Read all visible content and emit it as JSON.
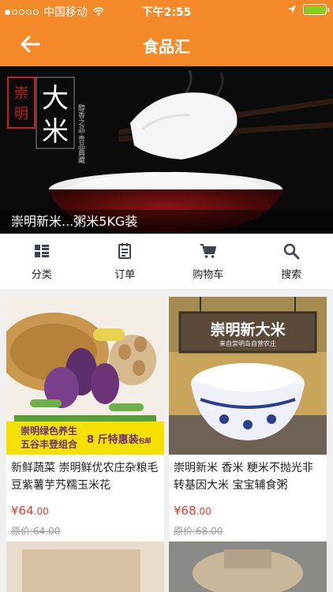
{
  "status_bar": {
    "carrier": "中国移动",
    "time": "下午2:55",
    "battery_color": "#7ed321"
  },
  "nav": {
    "title": "食品汇",
    "back_icon": "arrow-left-icon"
  },
  "banner": {
    "caption": "崇明新米...粥米5KG装",
    "seal_text": "崇明",
    "title_text": "大米",
    "vertical_text": "醇香之品 · 贵品典藏"
  },
  "quick_nav": [
    {
      "label": "分类",
      "icon": "category-grid-icon"
    },
    {
      "label": "订单",
      "icon": "order-list-icon"
    },
    {
      "label": "购物车",
      "icon": "shopping-cart-icon"
    },
    {
      "label": "搜索",
      "icon": "search-icon"
    }
  ],
  "products": [
    {
      "name": "新鲜蔬菜 崇明鲜优农庄杂粮毛豆紫薯芋艿糯玉米花",
      "currency": "¥",
      "price_int": "64",
      "price_dec": ".00",
      "original": "原价:64.00",
      "promo_line1": "崇明绿色养生",
      "promo_line2": "五谷丰登组合",
      "promo_right": "8 斤特惠装",
      "promo_small": "包邮"
    },
    {
      "name": "崇明新米 香米 粳米不抛光非转基因大米 宝宝辅食粥",
      "currency": "¥",
      "price_int": "68",
      "price_dec": ".00",
      "original": "原价:68.00",
      "sign_title": "崇明新大米",
      "sign_sub": "来自崇明岛自营农庄"
    }
  ],
  "colors": {
    "accent": "#f4892a",
    "price": "#e83a26"
  }
}
